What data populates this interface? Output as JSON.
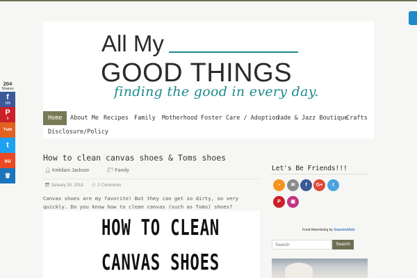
{
  "colors": {
    "accent": "#777a55",
    "teal": "#1b8a8c",
    "facebook": "#3b5998",
    "pinterest": "#cb2027",
    "yummly": "#e16120",
    "twitter": "#1da1f2",
    "stumbleupon": "#eb4924",
    "managewp": "#1b75bc"
  },
  "logo": {
    "line1": "All My",
    "line2": "GOOD THINGS",
    "tagline": "finding the good in every day."
  },
  "nav": {
    "items": [
      {
        "label": "Home",
        "active": true
      },
      {
        "label": "About Me"
      },
      {
        "label": "Recipes"
      },
      {
        "label": "Family"
      },
      {
        "label": "Motherhood"
      },
      {
        "label": "Foster Care / Adoption"
      },
      {
        "label": "Jade & Jazz Boutique"
      },
      {
        "label": "Crafts"
      },
      {
        "label": "Disclosure/Policy"
      }
    ]
  },
  "share": {
    "total": "204",
    "total_label": "Shares",
    "buttons": [
      {
        "icon": "facebook-icon",
        "glyph": "f",
        "count": "195"
      },
      {
        "icon": "pinterest-icon",
        "glyph": "P",
        "count": "9"
      },
      {
        "icon": "yummly-icon",
        "glyph": "Yum",
        "count": ""
      },
      {
        "icon": "twitter-icon",
        "glyph": "t",
        "count": ""
      },
      {
        "icon": "stumbleupon-icon",
        "glyph": "su",
        "count": ""
      },
      {
        "icon": "crown-icon",
        "glyph": "♛",
        "count": ""
      }
    ]
  },
  "post": {
    "title": "How to clean canvas shoes & Toms shoes",
    "author": "Keikilani Jackson",
    "category": "Family",
    "date": "January 30, 2018",
    "comments": "2 Comments",
    "excerpt": "Canvas shoes are my favorite! But they can get so dirty, so very quickly. Do you know how to clean canvas (such as Toms) shoes?",
    "image_text_line1": "HOW TO CLEAN",
    "image_text_line2": "CANVAS SHOES"
  },
  "sidebar": {
    "title": "Let's Be Friends!!!",
    "social_icons": [
      "rss-icon",
      "email-icon",
      "facebook-icon",
      "google-plus-icon",
      "twitter-icon",
      "pinterest-icon",
      "instagram-icon"
    ],
    "food_ad_prefix": "Food Advertising by",
    "food_ad_brand": "GourmetAds",
    "search_placeholder": "Search",
    "search_button": "Search"
  }
}
